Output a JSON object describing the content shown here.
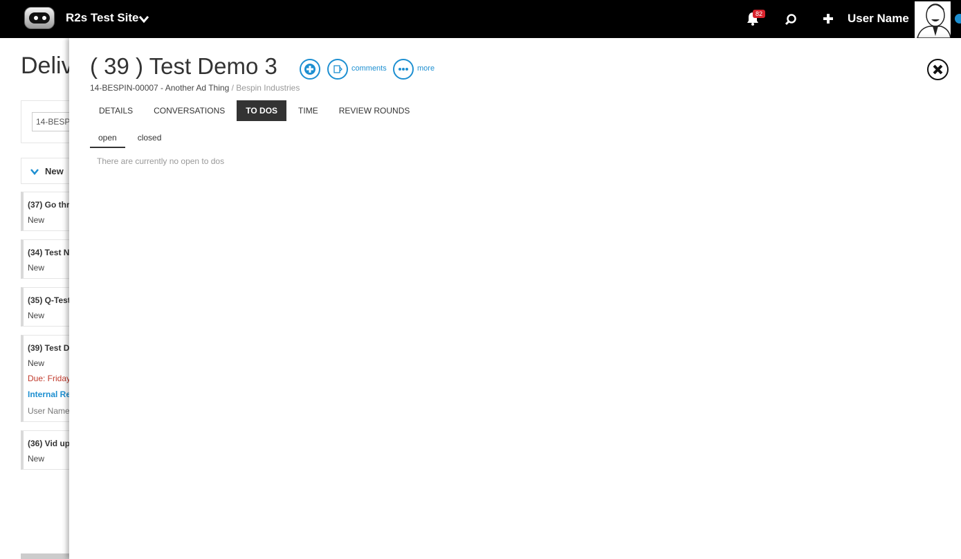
{
  "topbar": {
    "site_name": "R2s Test Site",
    "notification_count": "82",
    "user_name": "User Name"
  },
  "background": {
    "page_title": "Deliv",
    "filter_value": "14-BESPI",
    "group_label": "New",
    "cards": [
      {
        "title": "(37) Go thr",
        "status": "New"
      },
      {
        "title": "(34) Test N",
        "status": "New"
      },
      {
        "title": "(35) Q-Test",
        "status": "New"
      },
      {
        "title": "(39) Test D",
        "status": "New",
        "due": "Due: Friday",
        "link": "Internal Re",
        "user": "User Name"
      },
      {
        "title": "(36) Vid up",
        "status": "New"
      }
    ]
  },
  "panel": {
    "title": "( 39 ) Test Demo 3",
    "comments_label": "comments",
    "more_label": "more",
    "job_ref": "14-BESPIN-00007 - Another Ad Thing",
    "client": "/ Bespin Industries",
    "tabs": [
      "DETAILS",
      "CONVERSATIONS",
      "TO DOS",
      "TIME",
      "REVIEW ROUNDS"
    ],
    "active_tab": "TO DOS",
    "subtabs": [
      "open",
      "closed"
    ],
    "active_subtab": "open",
    "empty_message": "There are currently no open to dos"
  },
  "colors": {
    "accent": "#1d8fd1",
    "badge": "#d9232d",
    "topbar": "#000000",
    "due": "#c0392b"
  }
}
